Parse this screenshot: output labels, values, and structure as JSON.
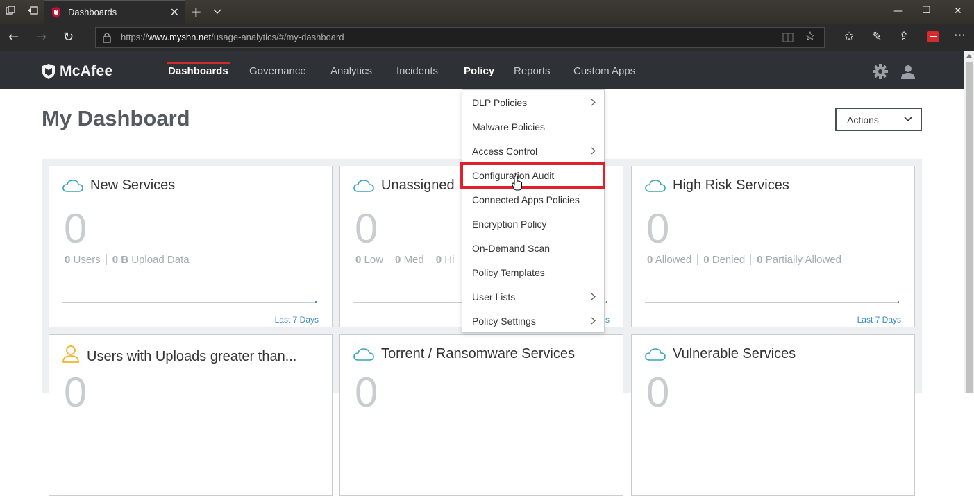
{
  "browser": {
    "tab_title": "Dashboards",
    "url_prefix": "https://",
    "url_host": "www.myshn.net",
    "url_path": "/usage-analytics/#/my-dashboard"
  },
  "icons": {
    "tab_actions": "tab-actions-icon",
    "set_aside": "set-aside-tabs-icon",
    "favicon": "mcafee-favicon",
    "back": "back-arrow-icon",
    "forward": "forward-arrow-icon",
    "refresh": "refresh-icon",
    "lock": "lock-icon",
    "reading_view": "reading-view-icon",
    "favorite": "star-icon",
    "favorites_hub": "favorites-list-icon",
    "pen": "pen-icon",
    "share": "share-icon",
    "extension": "extension-icon",
    "more": "more-icon",
    "settings": "gear-icon",
    "user": "user-icon",
    "cloud": "cloud-icon",
    "person": "person-icon"
  },
  "colors": {
    "header_bg": "#2e3136",
    "active_underline": "#d02b2b",
    "highlight": "#e0202a",
    "link": "#3a8cc4"
  },
  "app": {
    "logo_text": "McAfee",
    "nav": [
      {
        "label": "Dashboards"
      },
      {
        "label": "Governance"
      },
      {
        "label": "Analytics"
      },
      {
        "label": "Incidents"
      },
      {
        "label": "Policy"
      },
      {
        "label": "Reports"
      },
      {
        "label": "Custom Apps"
      }
    ]
  },
  "page": {
    "title": "My Dashboard",
    "actions_label": "Actions"
  },
  "policy_menu": [
    {
      "label": "DLP Policies",
      "submenu": true
    },
    {
      "label": "Malware Policies",
      "submenu": false
    },
    {
      "label": "Access Control",
      "submenu": true
    },
    {
      "label": "Configuration Audit",
      "submenu": false
    },
    {
      "label": "Connected Apps Policies",
      "submenu": false
    },
    {
      "label": "Encryption Policy",
      "submenu": false
    },
    {
      "label": "On-Demand Scan",
      "submenu": false
    },
    {
      "label": "Policy Templates",
      "submenu": false
    },
    {
      "label": "User Lists",
      "submenu": true
    },
    {
      "label": "Policy Settings",
      "submenu": true
    }
  ],
  "cards": [
    {
      "title": "New Services",
      "value": "0",
      "stats": [
        {
          "num": "0",
          "label": "Users"
        },
        {
          "num": "0 B",
          "label": "Upload Data"
        }
      ],
      "link": "Last 7 Days"
    },
    {
      "title": "Unassigned",
      "value": "0",
      "stats": [
        {
          "num": "0",
          "label": "Low"
        },
        {
          "num": "0",
          "label": "Med"
        },
        {
          "num": "0",
          "label": "Hi"
        }
      ],
      "link": "ys"
    },
    {
      "title": "High Risk Services",
      "value": "0",
      "stats": [
        {
          "num": "0",
          "label": "Allowed"
        },
        {
          "num": "0",
          "label": "Denied"
        },
        {
          "num": "0",
          "label": "Partially Allowed"
        }
      ],
      "link": "Last 7 Days"
    },
    {
      "title": "Users with Uploads greater than...",
      "value": "0"
    },
    {
      "title": "Torrent / Ransomware Services",
      "value": "0"
    },
    {
      "title": "Vulnerable Services",
      "value": "0"
    }
  ]
}
